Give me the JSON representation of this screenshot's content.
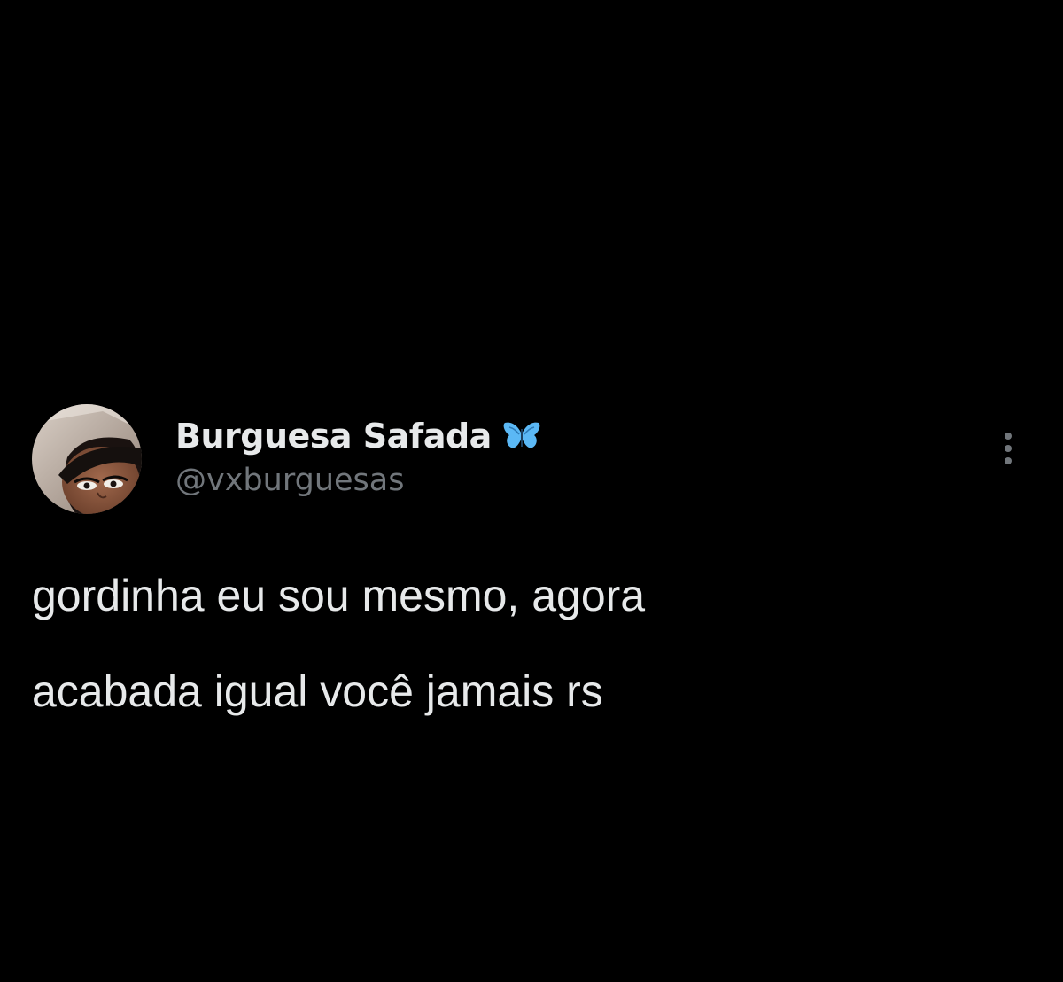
{
  "tweet": {
    "author": {
      "display_name": "Burguesa Safada",
      "handle": "@vxburguesas",
      "badge_icon": "butterfly-icon",
      "avatar": "profile-photo"
    },
    "text_lines": [
      "gordinha eu sou mesmo, agora",
      "acabada igual você jamais rs"
    ],
    "menu_icon": "more-vertical-icon"
  },
  "colors": {
    "background": "#000000",
    "primary_text": "#e7e9ea",
    "secondary_text": "#71767b",
    "badge": "#5bb8f5"
  }
}
